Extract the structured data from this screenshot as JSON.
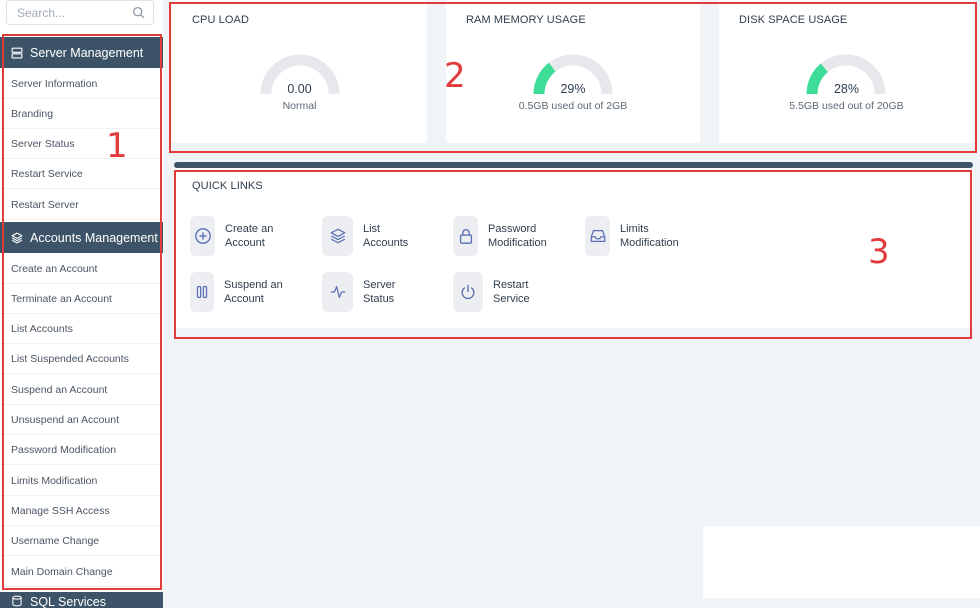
{
  "search": {
    "placeholder": "Search..."
  },
  "sidebar": {
    "server_management": {
      "label": "Server Management",
      "items": [
        "Server Information",
        "Branding",
        "Server Status",
        "Restart Service",
        "Restart Server"
      ]
    },
    "accounts_management": {
      "label": "Accounts Management",
      "items": [
        "Create an Account",
        "Terminate an Account",
        "List Accounts",
        "List Suspended Accounts",
        "Suspend an Account",
        "Unsuspend an Account",
        "Password Modification",
        "Limits Modification",
        "Manage SSH Access",
        "Username Change",
        "Main Domain Change"
      ]
    },
    "sql_services": {
      "label": "SQL Services"
    }
  },
  "stats": {
    "cpu": {
      "title": "CPU LOAD",
      "value": "0.00",
      "sub": "Normal",
      "fraction": 0.0
    },
    "ram": {
      "title": "RAM MEMORY USAGE",
      "value": "29%",
      "sub": "0.5GB used out of 2GB",
      "fraction": 0.29
    },
    "disk": {
      "title": "DISK SPACE USAGE",
      "value": "28%",
      "sub": "5.5GB used out of 20GB",
      "fraction": 0.28
    }
  },
  "quick_links": {
    "title": "QUICK LINKS",
    "items": [
      {
        "line1": "Create an",
        "line2": "Account",
        "icon": "plus-circle-icon"
      },
      {
        "line1": "List",
        "line2": "Accounts",
        "icon": "layers-icon"
      },
      {
        "line1": "Password",
        "line2": "Modification",
        "icon": "lock-icon"
      },
      {
        "line1": "Limits",
        "line2": "Modification",
        "icon": "inbox-icon"
      },
      {
        "line1": "Suspend an",
        "line2": "Account",
        "icon": "pause-icon"
      },
      {
        "line1": "Server",
        "line2": "Status",
        "icon": "activity-icon"
      },
      {
        "line1": "Restart",
        "line2": "Service",
        "icon": "power-icon"
      }
    ]
  },
  "annotations": {
    "a1": "1",
    "a2": "2",
    "a3": "3"
  },
  "colors": {
    "accent": "#3d5468",
    "gauge_fill": "#3ddc97",
    "gauge_track": "#e6e8eb",
    "annotation": "#e23b3b"
  }
}
